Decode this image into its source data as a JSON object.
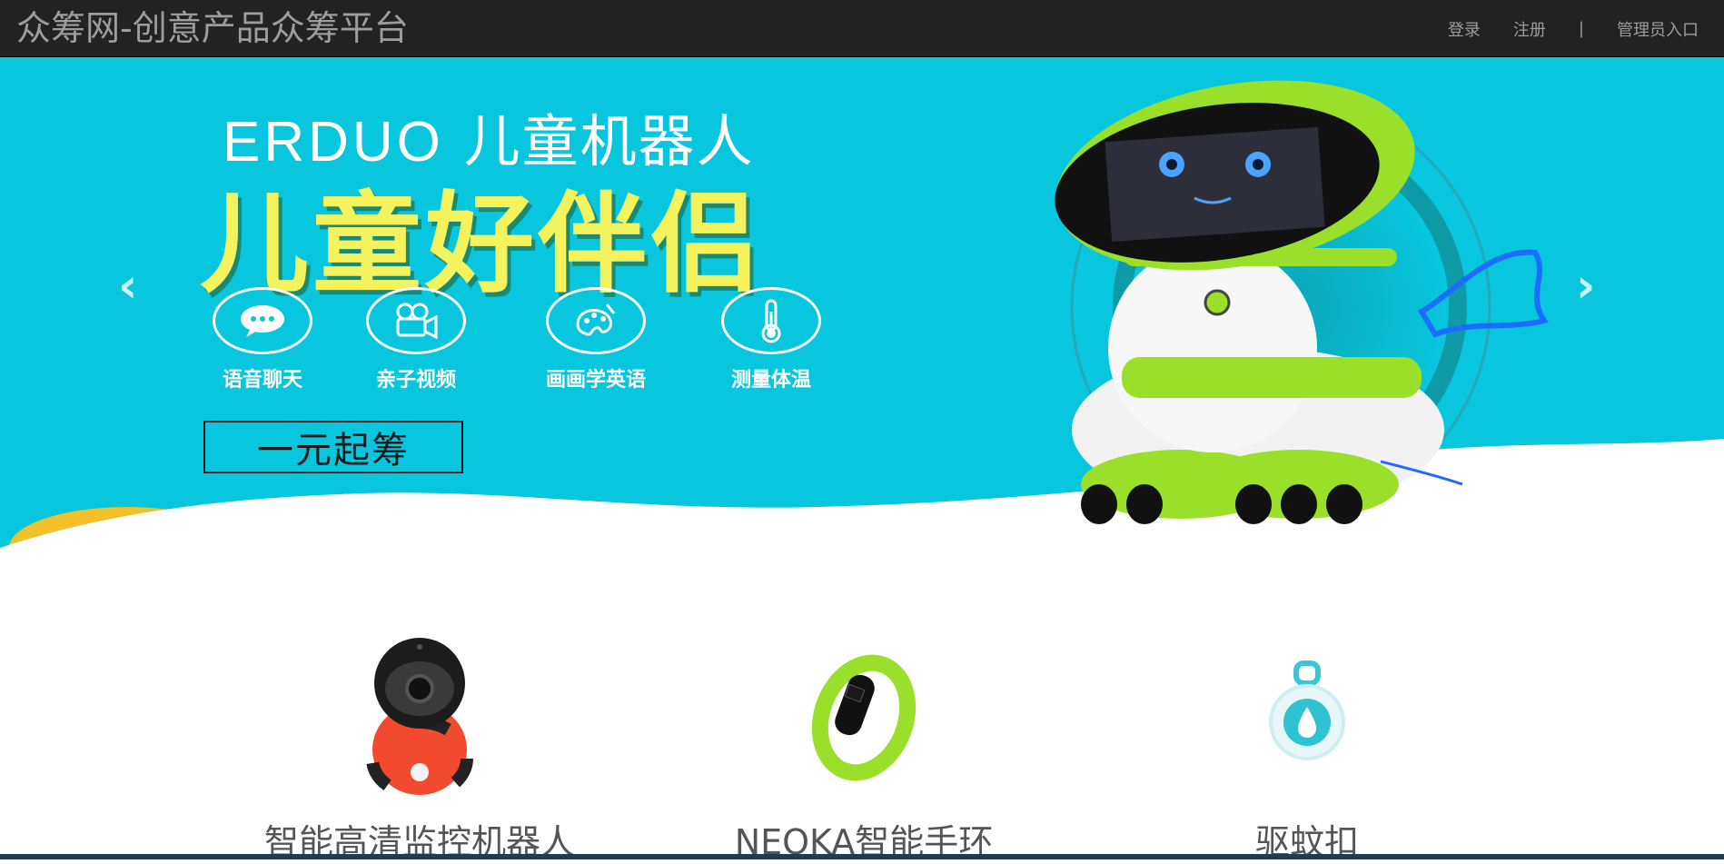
{
  "navbar": {
    "brand": "众筹网-创意产品众筹平台",
    "login": "登录",
    "register": "注册",
    "separator": "|",
    "admin": "管理员入口"
  },
  "carousel": {
    "brand_logo": "ERDUO",
    "brand_text": "儿童机器人",
    "slogan": "儿童好伴侣",
    "features": [
      {
        "label": "语音聊天",
        "icon": "chat-bubble-icon"
      },
      {
        "label": "亲子视频",
        "icon": "video-camera-icon"
      },
      {
        "label": "画画学英语",
        "icon": "palette-icon"
      },
      {
        "label": "测量体温",
        "icon": "thermometer-icon"
      }
    ],
    "cta": "一元起筹",
    "prev_icon": "‹",
    "next_icon": "›",
    "slide_count": 3,
    "active_slide": 1,
    "colors": {
      "background": "#07c6dd",
      "slogan": "#f4f35e",
      "accent_green": "#9ae02b"
    }
  },
  "products": [
    {
      "name": "智能高清监控机器人",
      "icon": "monitor-robot-icon"
    },
    {
      "name": "NEOKA智能手环",
      "icon": "smart-band-icon"
    },
    {
      "name": "驱蚊扣",
      "icon": "mosquito-repellent-icon"
    }
  ]
}
